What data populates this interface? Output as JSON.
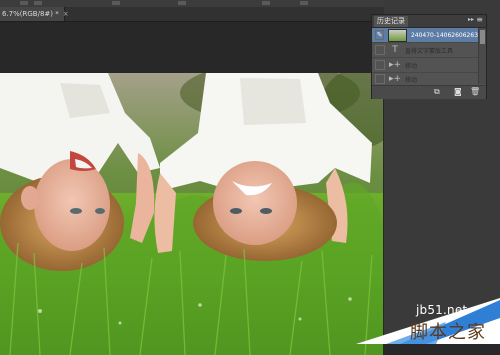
{
  "document": {
    "tab_label": "6.7%(RGB/8#) *",
    "close_label": "×"
  },
  "history_panel": {
    "title": "历史记录",
    "collapse_glyph": "▸▸",
    "menu_glyph": "≡",
    "items": [
      {
        "label": "240470-14062606263...",
        "icon": "snapshot-thumbnail",
        "selected": true
      },
      {
        "label": "直排文字蒙版工具",
        "icon": "vertical-type-mask-icon",
        "selected": false
      },
      {
        "label": "移动",
        "icon": "move-tool-icon",
        "selected": false
      },
      {
        "label": "移动",
        "icon": "move-tool-icon",
        "selected": false
      }
    ],
    "footer_buttons": [
      {
        "name": "create-new-document-from-state-button",
        "glyph": "⧉"
      },
      {
        "name": "camera-icon",
        "glyph": "◙"
      },
      {
        "name": "trash-icon",
        "glyph": "🗑"
      }
    ]
  },
  "watermark": {
    "url": "jb51.net",
    "title": "脚本之家"
  },
  "colors": {
    "panel_selected": "#5d7da6",
    "app_background": "#282828",
    "watermark_blue": "#2f7fd6"
  }
}
